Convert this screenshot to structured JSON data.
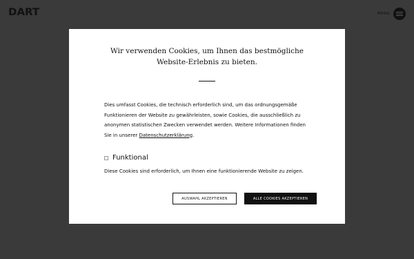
{
  "header": {
    "logo": "DART",
    "menu_label": "MENU",
    "menu_icon": "menu-icon"
  },
  "cookie_modal": {
    "title": "Wir verwenden Cookies, um Ihnen das bestmögliche Website-Erlebnis zu bieten.",
    "description_before_link": "Dies umfasst Cookies, die technisch erforderlich sind, um das ordnungsgemäße Funktionieren der Website zu gewährleisten, sowie Cookies, die ausschließlich zu anonymen statistischen Zwecken verwendet werden. Weitere Informationen finden Sie in unserer ",
    "privacy_link": "Datenschutzerklärung",
    "description_after_link": ".",
    "category_label": "Funktional",
    "category_description": "Diese Cookies sind erforderlich, um Ihnen eine funktionierende Website zu zeigen.",
    "accept_selection_label": "AUSWAHL AKZEPTIEREN",
    "accept_all_label": "ALLE COOKIES AKZEPTIEREN"
  },
  "colors": {
    "overlay": "#3a3a3a",
    "modal_bg": "#ffffff",
    "text": "#111111",
    "primary_button": "#111111"
  }
}
